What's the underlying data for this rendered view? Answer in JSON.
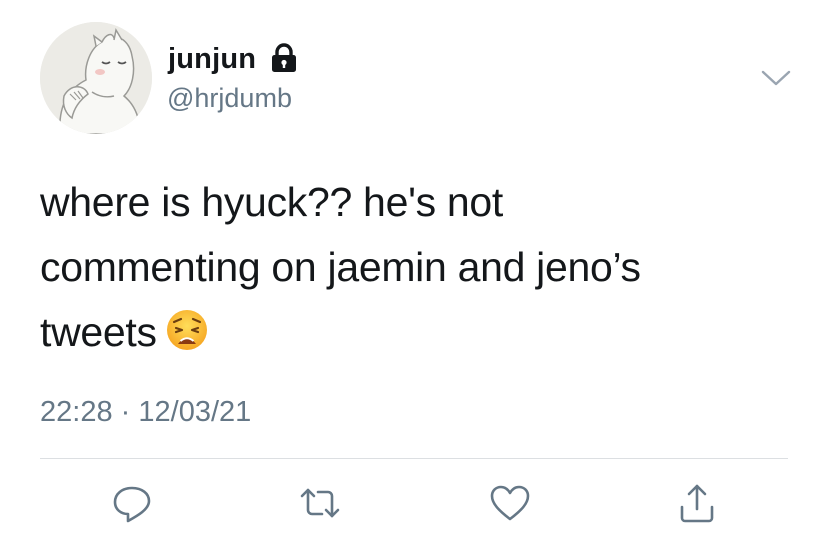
{
  "user": {
    "display_name": "junjun",
    "handle": "@hrjdumb",
    "protected_icon": "lock-icon",
    "avatar": "moomin-avatar"
  },
  "tweet": {
    "lines": [
      "where is hyuck?? he's not",
      "commenting on jaemin and jeno’s",
      "tweets"
    ],
    "emoji": "weary-face-emoji",
    "time": "22:28",
    "separator": "·",
    "date": "12/03/21"
  },
  "actions": {
    "reply_icon": "reply-icon",
    "retweet_icon": "retweet-icon",
    "like_icon": "heart-icon",
    "share_icon": "share-icon",
    "more_icon": "chevron-down-icon"
  },
  "colors": {
    "text": "#14171a",
    "secondary": "#657786",
    "divider": "#dcdfe2",
    "background": "#ffffff"
  }
}
